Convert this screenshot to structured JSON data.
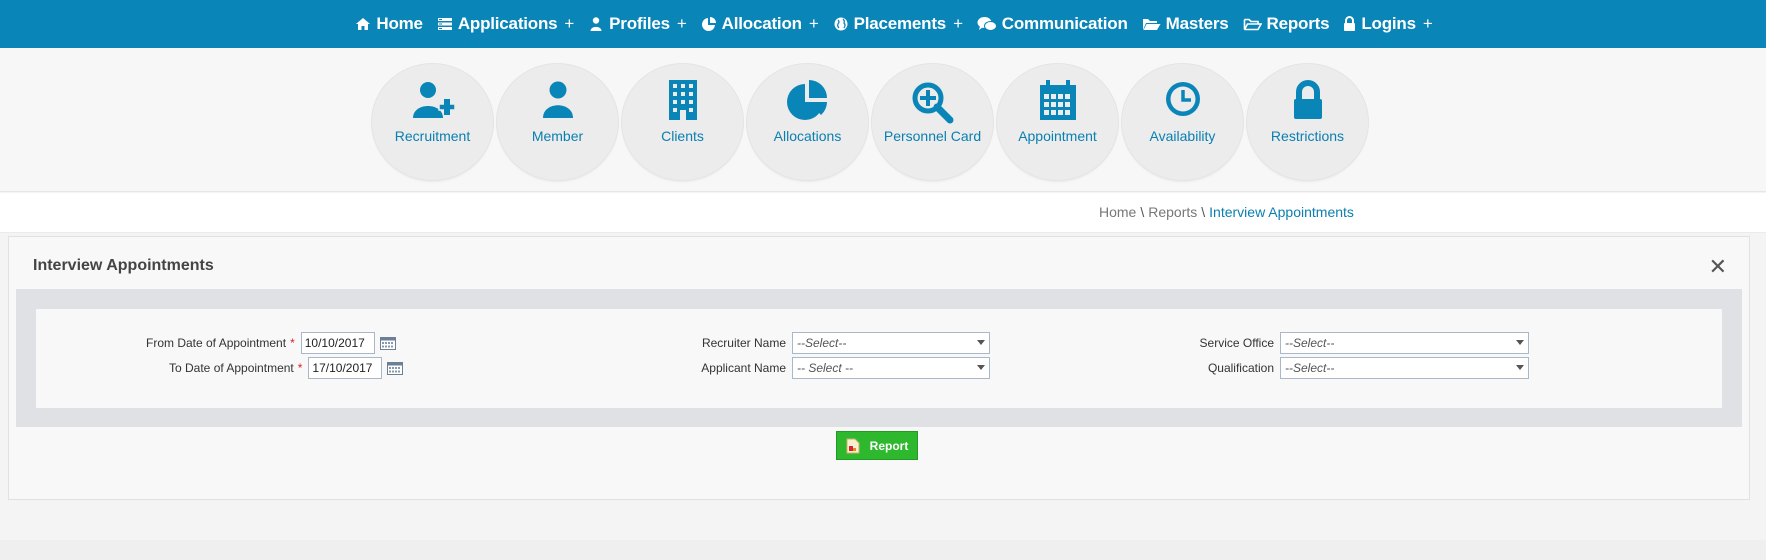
{
  "nav": {
    "items": [
      {
        "label": "Home",
        "icon": "home-icon",
        "expandable": false
      },
      {
        "label": "Applications",
        "icon": "applications-icon",
        "expandable": true
      },
      {
        "label": "Profiles",
        "icon": "user-icon",
        "expandable": true
      },
      {
        "label": "Allocation",
        "icon": "pie-chart-icon",
        "expandable": true
      },
      {
        "label": "Placements",
        "icon": "globe-icon",
        "expandable": true
      },
      {
        "label": "Communication",
        "icon": "chat-icon",
        "expandable": false
      },
      {
        "label": "Masters",
        "icon": "folder-open-icon",
        "expandable": false
      },
      {
        "label": "Reports",
        "icon": "folder-outline-icon",
        "expandable": false
      },
      {
        "label": "Logins",
        "icon": "lock-icon",
        "expandable": true
      }
    ],
    "plus_symbol": "+"
  },
  "tiles": [
    {
      "label": "Recruitment",
      "icon": "add-user-icon"
    },
    {
      "label": "Member",
      "icon": "user-icon"
    },
    {
      "label": "Clients",
      "icon": "building-icon"
    },
    {
      "label": "Allocations",
      "icon": "pie-chart-icon"
    },
    {
      "label": "Personnel Card",
      "icon": "search-plus-icon"
    },
    {
      "label": "Appointment",
      "icon": "calendar-icon"
    },
    {
      "label": "Availability",
      "icon": "clock-icon"
    },
    {
      "label": "Restrictions",
      "icon": "lock-icon"
    }
  ],
  "breadcrumb": {
    "home": "Home",
    "reports": "Reports",
    "current": "Interview Appointments",
    "separator": "\\"
  },
  "panel": {
    "title": "Interview Appointments",
    "close_symbol": "✕"
  },
  "form": {
    "from_date": {
      "label": "From Date of Appointment",
      "required_mark": "*",
      "value": "10/10/2017"
    },
    "to_date": {
      "label": "To Date of Appointment",
      "required_mark": "*",
      "value": "17/10/2017"
    },
    "recruiter_name": {
      "label": "Recruiter Name",
      "value": "--Select--"
    },
    "applicant_name": {
      "label": "Applicant Name",
      "value": "-- Select --"
    },
    "service_office": {
      "label": "Service Office",
      "value": "--Select--"
    },
    "qualification": {
      "label": "Qualification",
      "value": "--Select--"
    }
  },
  "report_button": {
    "label": "Report"
  },
  "colors": {
    "nav_bg": "#0a85b8",
    "accent": "#0a7fb0",
    "report_button": "#2db82d",
    "required": "#dd2222"
  }
}
